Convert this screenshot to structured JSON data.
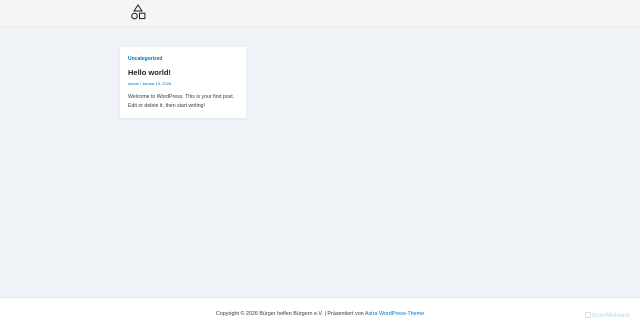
{
  "header": {
    "logo_icon": "triangle-circle-square-logo-icon"
  },
  "post": {
    "category": "Uncategorized",
    "title": "Hello world!",
    "author": "admin",
    "meta_separator": " / ",
    "date": "Januar 15, 2026",
    "excerpt": "Welcome to WordPress. This is your first post. Edit or delete it, then start writing!"
  },
  "footer": {
    "copyright_text": "Copyright © 2026 Bürger helfen Bürgern e.V. | Präsentiert von ",
    "theme_link": "Astra WordPress-Theme"
  },
  "watermark": {
    "text": "ScanMalware"
  },
  "colors": {
    "page_background": "#eff3f8",
    "header_background": "#f5f5f5",
    "link": "#0274be",
    "card_background": "#ffffff",
    "watermark": "#cde3ee"
  }
}
